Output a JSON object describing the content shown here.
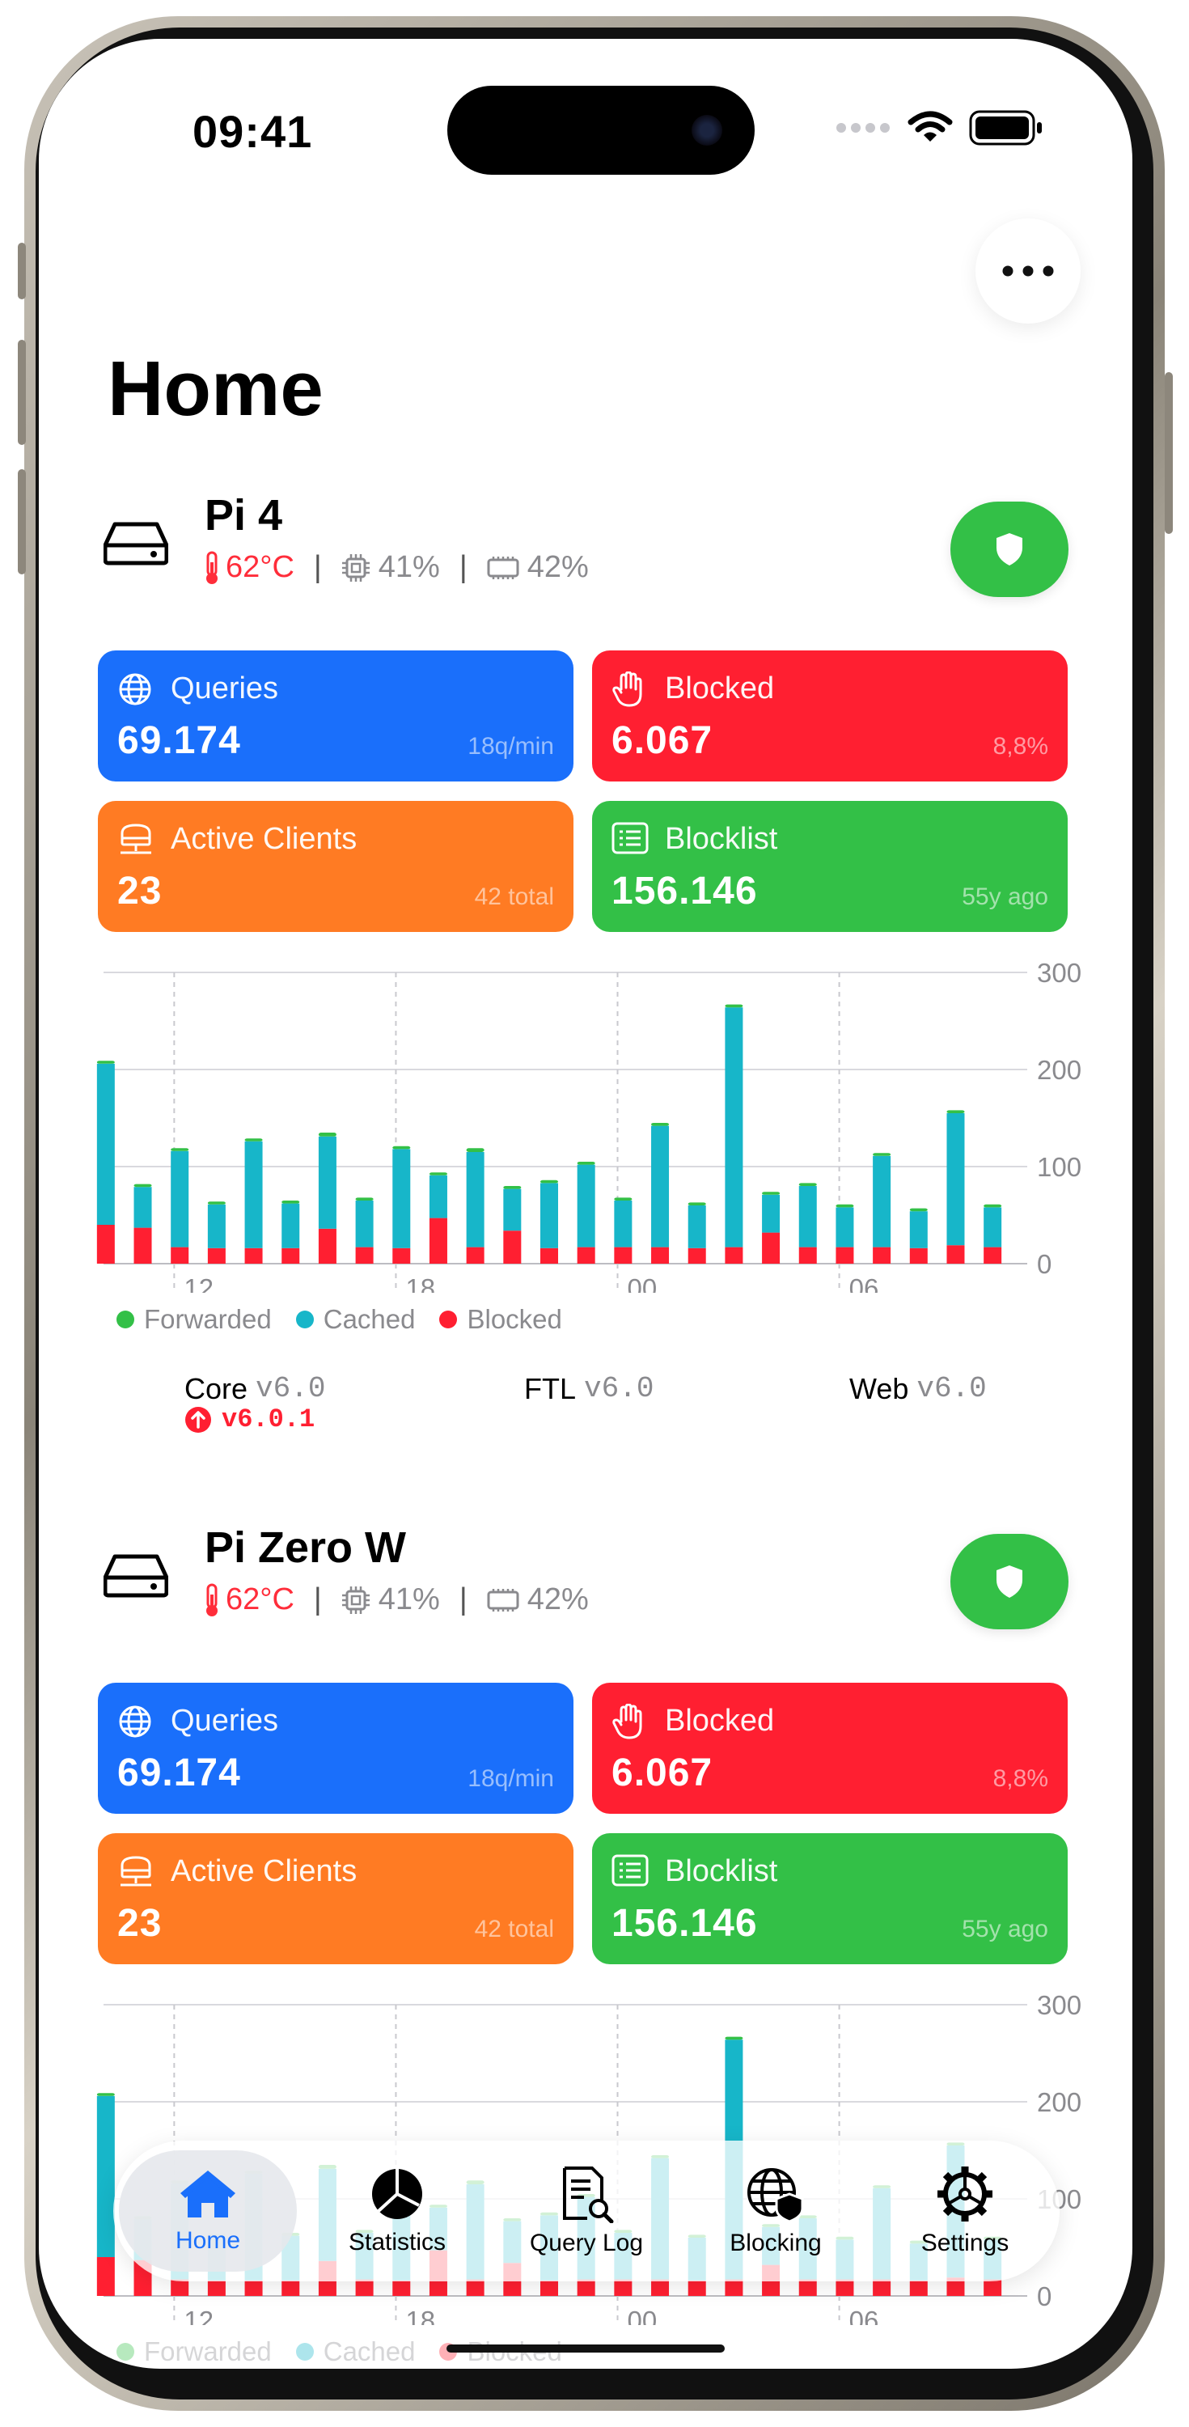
{
  "status_bar": {
    "time": "09:41"
  },
  "header": {
    "title": "Home",
    "menu_icon": "ellipsis-icon"
  },
  "servers": [
    {
      "name": "Pi 4",
      "temp": "62°C",
      "cpu": "41%",
      "memory": "42%",
      "blocking_enabled": true,
      "tiles": {
        "queries": {
          "label": "Queries",
          "value": "69.174",
          "sub": "18q/min"
        },
        "blocked": {
          "label": "Blocked",
          "value": "6.067",
          "sub": "8,8%"
        },
        "clients": {
          "label": "Active Clients",
          "value": "23",
          "sub": "42 total"
        },
        "blocklist": {
          "label": "Blocklist",
          "value": "156.146",
          "sub": "55y ago"
        }
      },
      "versions": {
        "core_label": "Core",
        "core": "v6.0",
        "ftl_label": "FTL",
        "ftl": "v6.0",
        "web_label": "Web",
        "web": "v6.0",
        "core_update": "v6.0.1"
      }
    },
    {
      "name": "Pi Zero W",
      "temp": "62°C",
      "cpu": "41%",
      "memory": "42%",
      "blocking_enabled": true,
      "tiles": {
        "queries": {
          "label": "Queries",
          "value": "69.174",
          "sub": "18q/min"
        },
        "blocked": {
          "label": "Blocked",
          "value": "6.067",
          "sub": "8,8%"
        },
        "clients": {
          "label": "Active Clients",
          "value": "23",
          "sub": "42 total"
        },
        "blocklist": {
          "label": "Blocklist",
          "value": "156.146",
          "sub": "55y ago"
        }
      }
    }
  ],
  "chart_data": {
    "type": "bar",
    "stacked": true,
    "ylim": [
      0,
      300
    ],
    "y_ticks": [
      0,
      100,
      200,
      300
    ],
    "x_tick_labels": [
      "12",
      "18",
      "00",
      "06"
    ],
    "x_tick_positions": [
      2,
      8,
      14,
      20
    ],
    "series": [
      {
        "name": "Forwarded",
        "color": "#33c047",
        "values": [
          3,
          3,
          3,
          3,
          3,
          3,
          4,
          3,
          3,
          3,
          4,
          3,
          3,
          3,
          3,
          3,
          3,
          3,
          3,
          3,
          3,
          3,
          3,
          3,
          3
        ]
      },
      {
        "name": "Cached",
        "color": "#17b6c9",
        "values": [
          166,
          42,
          99,
          45,
          110,
          46,
          95,
          48,
          102,
          44,
          98,
          43,
          67,
          85,
          48,
          125,
          44,
          247,
          39,
          63,
          41,
          94,
          38,
          136,
          41
        ]
      },
      {
        "name": "Blocked",
        "color": "#ff1f31",
        "values": [
          40,
          37,
          17,
          16,
          16,
          16,
          36,
          17,
          16,
          47,
          17,
          34,
          16,
          17,
          17,
          17,
          16,
          17,
          32,
          17,
          17,
          17,
          16,
          19,
          17
        ]
      }
    ]
  },
  "tabs": [
    {
      "label": "Home",
      "icon": "house-icon",
      "active": true
    },
    {
      "label": "Statistics",
      "icon": "pie-chart-icon",
      "active": false
    },
    {
      "label": "Query Log",
      "icon": "query-log-icon",
      "active": false
    },
    {
      "label": "Blocking",
      "icon": "globe-shield-icon",
      "active": false
    },
    {
      "label": "Settings",
      "icon": "gear-icon",
      "active": false
    }
  ]
}
